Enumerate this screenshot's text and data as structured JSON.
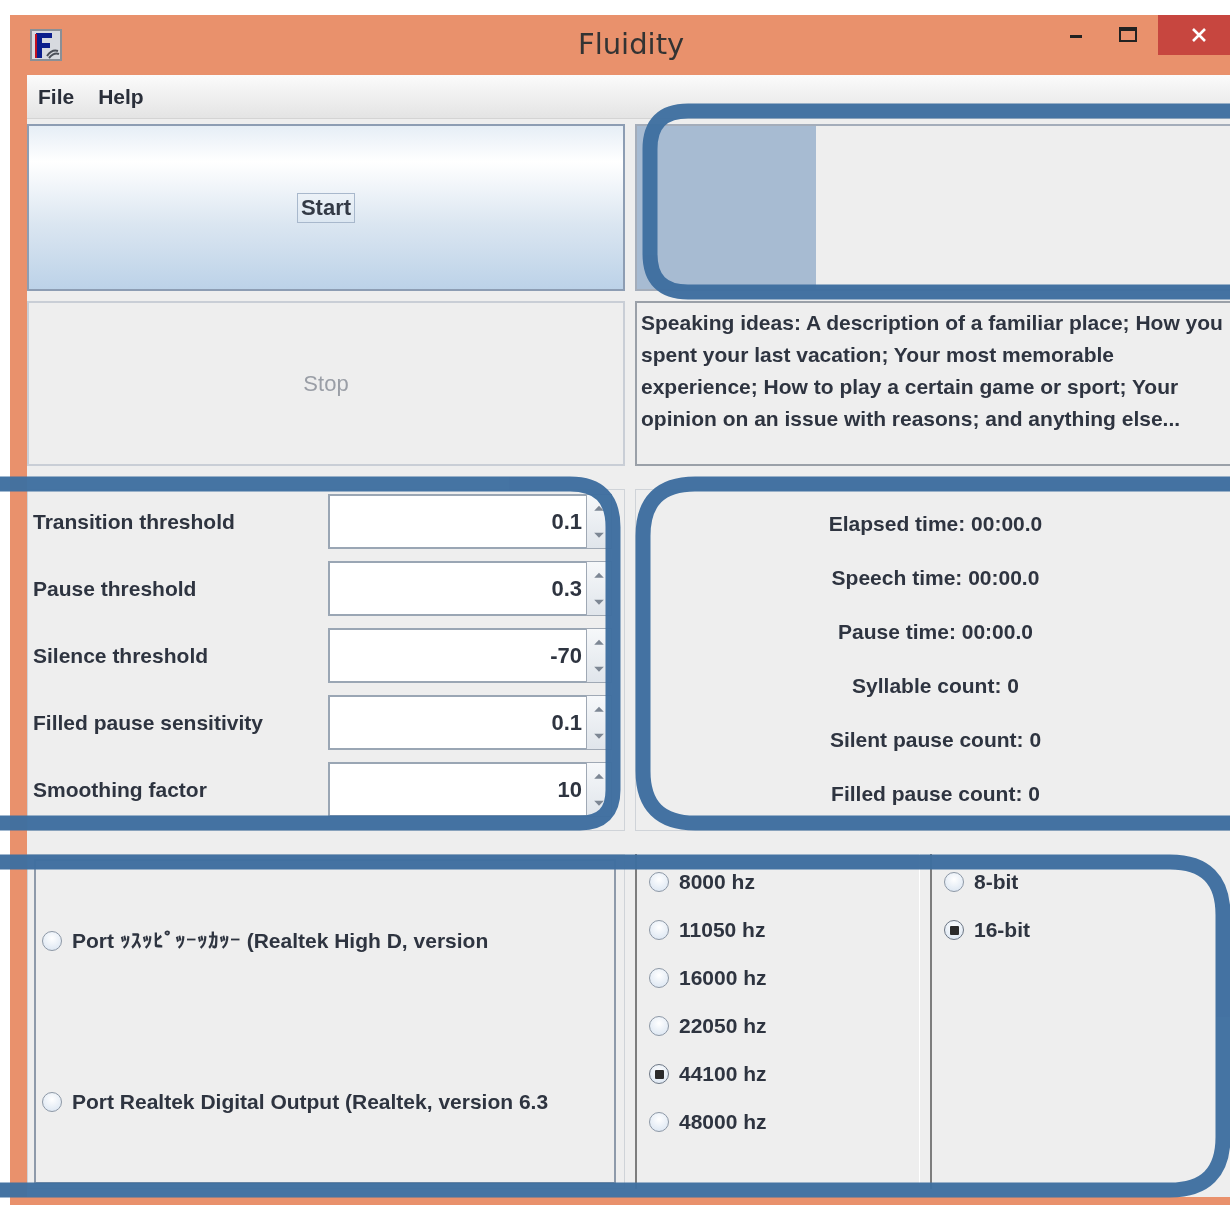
{
  "window": {
    "title": "Fluidity"
  },
  "menu": [
    "File",
    "Help"
  ],
  "buttons": [
    {
      "label": "Start",
      "disabled": false,
      "focused": true
    },
    {
      "label": "Stop",
      "disabled": true,
      "focused": false
    }
  ],
  "progress": {
    "level": 0.3
  },
  "speaking_ideas": "Speaking ideas: A description of a familiar place; How you spent your last vacation; Your most memorable experience; How to play a certain game or sport; Your opinion on an issue with reasons; and anything else...",
  "settings": [
    {
      "label": "Transition threshold",
      "value": "0.1"
    },
    {
      "label": "Pause threshold",
      "value": "0.3"
    },
    {
      "label": "Silence threshold",
      "value": "-70"
    },
    {
      "label": "Filled pause sensitivity",
      "value": "0.1"
    },
    {
      "label": "Smoothing factor",
      "value": "10"
    }
  ],
  "stats": [
    "Elapsed time: 00:00.0",
    "Speech time: 00:00.0",
    "Pause time: 00:00.0",
    "Syllable count: 0",
    "Silent pause count: 0",
    "Filled pause count: 0"
  ],
  "ports": [
    {
      "label": "Port ｯｽｯﾋﾟｯｰｯｶｯｰ (Realtek High D, version",
      "selected": false
    },
    {
      "label": "Port Realtek Digital Output (Realtek, version 6.3",
      "selected": false
    }
  ],
  "sample_rates": [
    {
      "label": "8000 hz",
      "selected": false
    },
    {
      "label": "11050 hz",
      "selected": false
    },
    {
      "label": "16000 hz",
      "selected": false
    },
    {
      "label": "22050 hz",
      "selected": false
    },
    {
      "label": "44100 hz",
      "selected": true
    },
    {
      "label": "48000 hz",
      "selected": false
    }
  ],
  "bit_depths": [
    {
      "label": "8-bit",
      "selected": false
    },
    {
      "label": "16-bit",
      "selected": true
    }
  ]
}
